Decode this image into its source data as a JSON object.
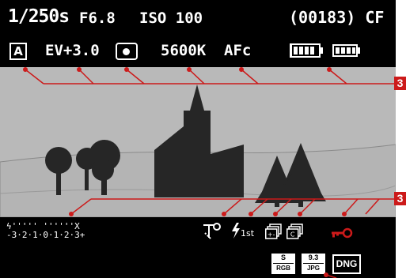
{
  "top_row": {
    "shutter": "1/250s",
    "aperture": "F6.8",
    "iso": "ISO 100",
    "shots_and_card": "(00183) CF"
  },
  "second_row": {
    "exposure_mode": "A",
    "ev_compensation": "EV+3.0",
    "metering_icon": "spot-metering-icon",
    "white_balance": "5600K",
    "focus_mode": "AFc",
    "battery_icons": [
      "grip-battery-icon",
      "camera-battery-icon"
    ]
  },
  "bottom_row": {
    "exposure_scale": "-3·2·1·0·1·2·3+",
    "flash_mode_icon": "flash-icon",
    "flash_sync": "1st",
    "icons": [
      "self-timer-icon",
      "bracketing-icon",
      "continuous-shooting-icon",
      "key-lock-icon"
    ],
    "file_format_rgb_top": "S",
    "file_format_rgb_bottom": "RGB",
    "file_format_jpg_top": "9.3",
    "file_format_jpg_bottom": "JPG",
    "dng_label": "DNG"
  },
  "callouts": {
    "top": "3",
    "bottom": "3"
  },
  "colors": {
    "accent_red": "#cc1a1a",
    "display_black": "#000000",
    "viewfinder_gray": "#b9b9b9",
    "scene_dark": "#262626"
  }
}
